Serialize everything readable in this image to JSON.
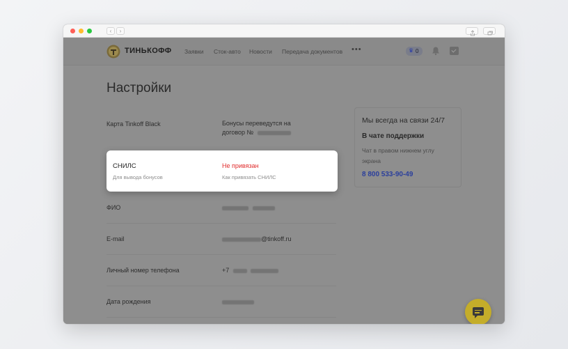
{
  "header": {
    "brand": "ТИНЬКОФФ",
    "nav": [
      "Заявки",
      "Сток-авто",
      "Новости",
      "Передача документов"
    ],
    "more": "•••",
    "bonus_count": "0"
  },
  "page_title": "Настройки",
  "rows": {
    "card": {
      "label": "Карта Tinkoff Black",
      "value_line1": "Бонусы переведутся на",
      "value_line2": "договор №"
    },
    "snils": {
      "label": "СНИЛС",
      "sub": "Для вывода бонусов",
      "status": "Не привязан",
      "link": "Как привязать СНИЛС"
    },
    "fio": {
      "label": "ФИО"
    },
    "email": {
      "label": "E-mail",
      "value_suffix": "@tinkoff.ru"
    },
    "phone": {
      "label": "Личный номер телефона",
      "value_prefix": "+7"
    },
    "dob": {
      "label": "Дата рождения"
    }
  },
  "support": {
    "title": "Мы всегда на связи 24/7",
    "subtitle": "В чате поддержки",
    "text": "Чат в правом нижнем углу экрана",
    "phone": "8 800 533-90-49"
  },
  "colors": {
    "status_red": "#e02b2b",
    "phone_blue": "#2b3f9c",
    "fab_yellow": "#c4ad2a"
  },
  "icons": [
    "logo-icon",
    "crown-icon",
    "bell-icon",
    "inbox-icon",
    "chat-icon",
    "share-icon",
    "tabs-icon",
    "back-icon",
    "forward-icon"
  ]
}
